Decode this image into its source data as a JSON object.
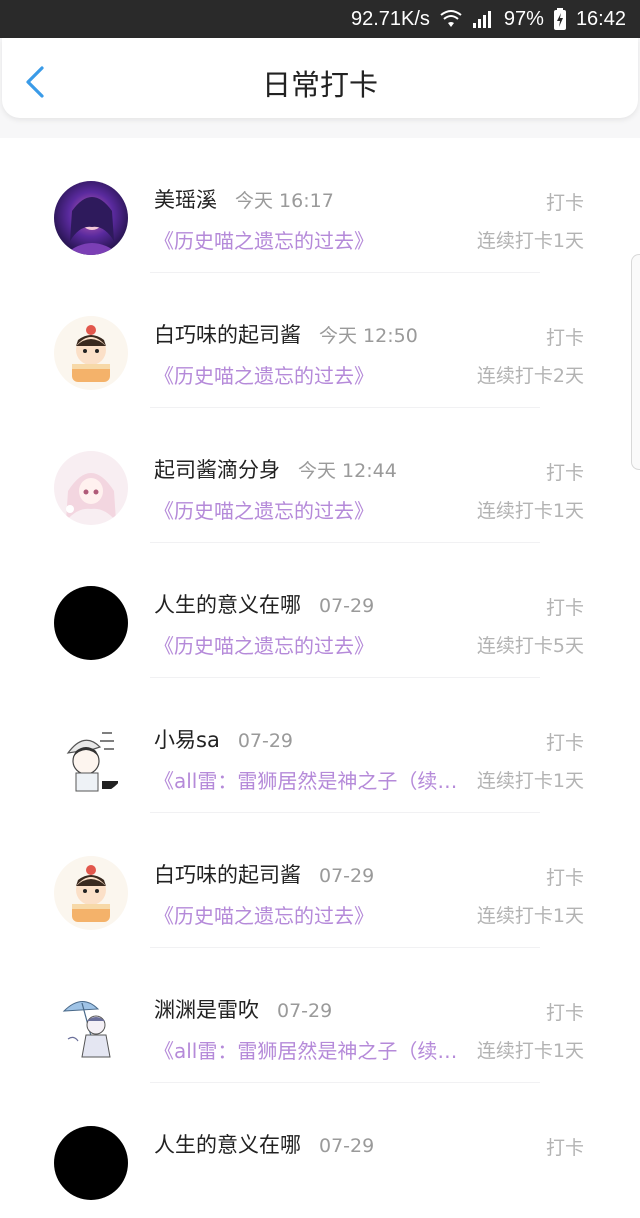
{
  "status_bar": {
    "speed": "92.71K/s",
    "battery": "97%",
    "time": "16:42"
  },
  "header": {
    "title": "日常打卡"
  },
  "rows": [
    {
      "name": "美瑶溪",
      "time": "今天 16:17",
      "action": "打卡",
      "book": "《历史喵之遗忘的过去》",
      "streak": "连续打卡1天",
      "avatar": "purple-girl"
    },
    {
      "name": "白巧味的起司酱",
      "time": "今天 12:50",
      "action": "打卡",
      "book": "《历史喵之遗忘的过去》",
      "streak": "连续打卡2天",
      "avatar": "cake-boy"
    },
    {
      "name": "起司酱滴分身",
      "time": "今天 12:44",
      "action": "打卡",
      "book": "《历史喵之遗忘的过去》",
      "streak": "连续打卡1天",
      "avatar": "pink-girl"
    },
    {
      "name": "人生的意义在哪",
      "time": "07-29",
      "action": "打卡",
      "book": "《历史喵之遗忘的过去》",
      "streak": "连续打卡5天",
      "avatar": "black"
    },
    {
      "name": "小易sa",
      "time": "07-29",
      "action": "打卡",
      "book": "《all雷：雷狮居然是神之子（续…",
      "streak": "连续打卡1天",
      "avatar": "sketch-boy"
    },
    {
      "name": "白巧味的起司酱",
      "time": "07-29",
      "action": "打卡",
      "book": "《历史喵之遗忘的过去》",
      "streak": "连续打卡1天",
      "avatar": "cake-boy"
    },
    {
      "name": "渊渊是雷吹",
      "time": "07-29",
      "action": "打卡",
      "book": "《all雷：雷狮居然是神之子（续…",
      "streak": "连续打卡1天",
      "avatar": "umbrella"
    },
    {
      "name": "人生的意义在哪",
      "time": "07-29",
      "action": "打卡",
      "book": "",
      "streak": "",
      "avatar": "black"
    }
  ]
}
